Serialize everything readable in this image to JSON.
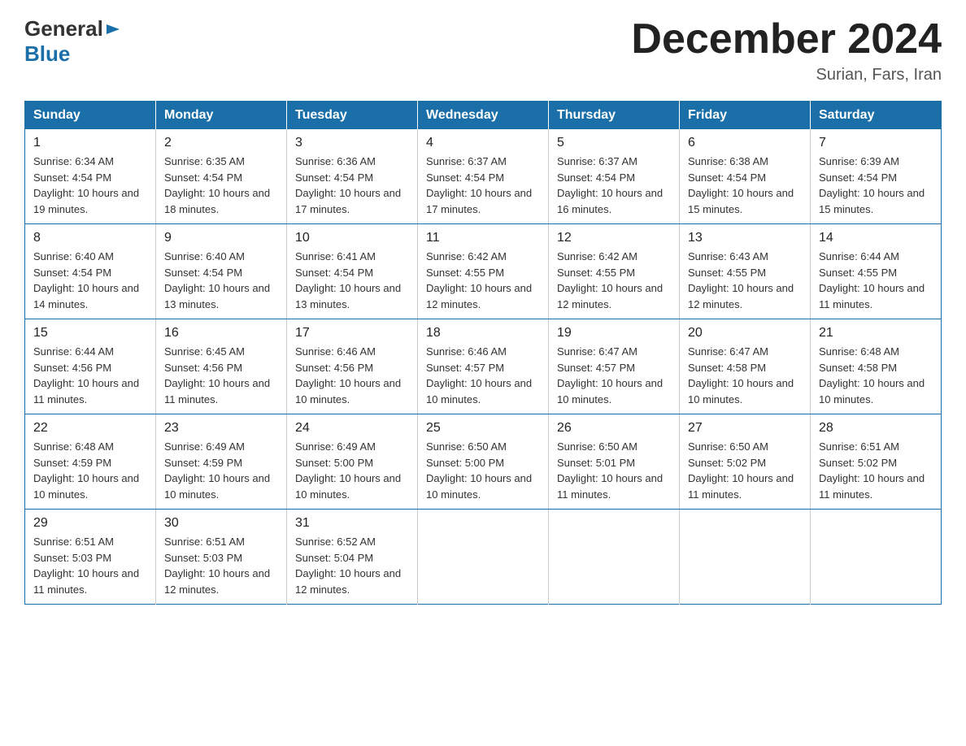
{
  "header": {
    "logo": {
      "general": "General",
      "blue": "Blue",
      "arrow": "▶"
    },
    "title": "December 2024",
    "subtitle": "Surian, Fars, Iran"
  },
  "calendar": {
    "days": [
      "Sunday",
      "Monday",
      "Tuesday",
      "Wednesday",
      "Thursday",
      "Friday",
      "Saturday"
    ],
    "weeks": [
      [
        {
          "num": "1",
          "sunrise": "6:34 AM",
          "sunset": "4:54 PM",
          "daylight": "10 hours and 19 minutes."
        },
        {
          "num": "2",
          "sunrise": "6:35 AM",
          "sunset": "4:54 PM",
          "daylight": "10 hours and 18 minutes."
        },
        {
          "num": "3",
          "sunrise": "6:36 AM",
          "sunset": "4:54 PM",
          "daylight": "10 hours and 17 minutes."
        },
        {
          "num": "4",
          "sunrise": "6:37 AM",
          "sunset": "4:54 PM",
          "daylight": "10 hours and 17 minutes."
        },
        {
          "num": "5",
          "sunrise": "6:37 AM",
          "sunset": "4:54 PM",
          "daylight": "10 hours and 16 minutes."
        },
        {
          "num": "6",
          "sunrise": "6:38 AM",
          "sunset": "4:54 PM",
          "daylight": "10 hours and 15 minutes."
        },
        {
          "num": "7",
          "sunrise": "6:39 AM",
          "sunset": "4:54 PM",
          "daylight": "10 hours and 15 minutes."
        }
      ],
      [
        {
          "num": "8",
          "sunrise": "6:40 AM",
          "sunset": "4:54 PM",
          "daylight": "10 hours and 14 minutes."
        },
        {
          "num": "9",
          "sunrise": "6:40 AM",
          "sunset": "4:54 PM",
          "daylight": "10 hours and 13 minutes."
        },
        {
          "num": "10",
          "sunrise": "6:41 AM",
          "sunset": "4:54 PM",
          "daylight": "10 hours and 13 minutes."
        },
        {
          "num": "11",
          "sunrise": "6:42 AM",
          "sunset": "4:55 PM",
          "daylight": "10 hours and 12 minutes."
        },
        {
          "num": "12",
          "sunrise": "6:42 AM",
          "sunset": "4:55 PM",
          "daylight": "10 hours and 12 minutes."
        },
        {
          "num": "13",
          "sunrise": "6:43 AM",
          "sunset": "4:55 PM",
          "daylight": "10 hours and 12 minutes."
        },
        {
          "num": "14",
          "sunrise": "6:44 AM",
          "sunset": "4:55 PM",
          "daylight": "10 hours and 11 minutes."
        }
      ],
      [
        {
          "num": "15",
          "sunrise": "6:44 AM",
          "sunset": "4:56 PM",
          "daylight": "10 hours and 11 minutes."
        },
        {
          "num": "16",
          "sunrise": "6:45 AM",
          "sunset": "4:56 PM",
          "daylight": "10 hours and 11 minutes."
        },
        {
          "num": "17",
          "sunrise": "6:46 AM",
          "sunset": "4:56 PM",
          "daylight": "10 hours and 10 minutes."
        },
        {
          "num": "18",
          "sunrise": "6:46 AM",
          "sunset": "4:57 PM",
          "daylight": "10 hours and 10 minutes."
        },
        {
          "num": "19",
          "sunrise": "6:47 AM",
          "sunset": "4:57 PM",
          "daylight": "10 hours and 10 minutes."
        },
        {
          "num": "20",
          "sunrise": "6:47 AM",
          "sunset": "4:58 PM",
          "daylight": "10 hours and 10 minutes."
        },
        {
          "num": "21",
          "sunrise": "6:48 AM",
          "sunset": "4:58 PM",
          "daylight": "10 hours and 10 minutes."
        }
      ],
      [
        {
          "num": "22",
          "sunrise": "6:48 AM",
          "sunset": "4:59 PM",
          "daylight": "10 hours and 10 minutes."
        },
        {
          "num": "23",
          "sunrise": "6:49 AM",
          "sunset": "4:59 PM",
          "daylight": "10 hours and 10 minutes."
        },
        {
          "num": "24",
          "sunrise": "6:49 AM",
          "sunset": "5:00 PM",
          "daylight": "10 hours and 10 minutes."
        },
        {
          "num": "25",
          "sunrise": "6:50 AM",
          "sunset": "5:00 PM",
          "daylight": "10 hours and 10 minutes."
        },
        {
          "num": "26",
          "sunrise": "6:50 AM",
          "sunset": "5:01 PM",
          "daylight": "10 hours and 11 minutes."
        },
        {
          "num": "27",
          "sunrise": "6:50 AM",
          "sunset": "5:02 PM",
          "daylight": "10 hours and 11 minutes."
        },
        {
          "num": "28",
          "sunrise": "6:51 AM",
          "sunset": "5:02 PM",
          "daylight": "10 hours and 11 minutes."
        }
      ],
      [
        {
          "num": "29",
          "sunrise": "6:51 AM",
          "sunset": "5:03 PM",
          "daylight": "10 hours and 11 minutes."
        },
        {
          "num": "30",
          "sunrise": "6:51 AM",
          "sunset": "5:03 PM",
          "daylight": "10 hours and 12 minutes."
        },
        {
          "num": "31",
          "sunrise": "6:52 AM",
          "sunset": "5:04 PM",
          "daylight": "10 hours and 12 minutes."
        },
        null,
        null,
        null,
        null
      ]
    ]
  }
}
